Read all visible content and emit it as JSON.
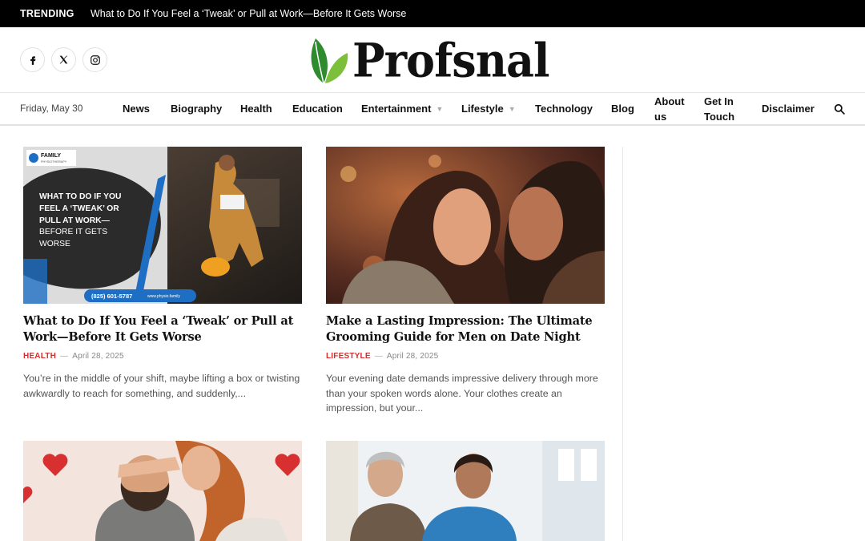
{
  "trending": {
    "label": "TRENDING",
    "headline": "What to Do If You Feel a ‘Tweak’ or Pull at Work—Before It Gets Worse"
  },
  "header": {
    "logo_text": "Profsnal",
    "social": [
      {
        "name": "facebook-icon"
      },
      {
        "name": "x-twitter-icon"
      },
      {
        "name": "instagram-icon"
      }
    ]
  },
  "nav": {
    "date": "Friday, May 30",
    "items": [
      {
        "label": "News"
      },
      {
        "label": "Biography"
      },
      {
        "label": "Health"
      },
      {
        "label": "Education"
      },
      {
        "label": "Entertainment",
        "has_dropdown": true
      },
      {
        "label": "Lifestyle",
        "has_dropdown": true
      },
      {
        "label": "Technology"
      },
      {
        "label": "Blog"
      },
      {
        "label": "About us"
      },
      {
        "label": "Get In Touch"
      },
      {
        "label": "Disclaimer"
      }
    ]
  },
  "posts": [
    {
      "title": "What to Do If You Feel a ‘Tweak’ or Pull at Work—Before It Gets Worse",
      "category": "HEALTH",
      "date": "April 28, 2025",
      "excerpt": "You’re in the middle of your shift, maybe lifting a box or twisting awkwardly to reach for something, and suddenly,...",
      "image": {
        "brand": "FAMILY",
        "brand_sub": "PHYSIOTHERAPY",
        "overlay_bold": "WHAT TO DO IF YOU FEEL A ‘TWEAK’ OR PULL AT WORK—",
        "overlay_light": "BEFORE IT GETS WORSE",
        "phone": "(825) 601-5787",
        "site": "www.physio.family"
      }
    },
    {
      "title": "Make a Lasting Impression: The Ultimate Grooming Guide for Men on Date Night",
      "category": "LIFESTYLE",
      "date": "April 28, 2025",
      "excerpt": "Your evening date demands impressive delivery through more than your spoken words alone. Your clothes create an impression, but your..."
    },
    {
      "title": "",
      "category": "",
      "date": "",
      "excerpt": ""
    },
    {
      "title": "",
      "category": "",
      "date": "",
      "excerpt": ""
    }
  ],
  "colors": {
    "accent": "#d62e2e",
    "topbar": "#000000",
    "logo_leaf_dark": "#2e8b2e",
    "logo_leaf_light": "#7bbf3a",
    "image_blue": "#1e6fc4"
  }
}
